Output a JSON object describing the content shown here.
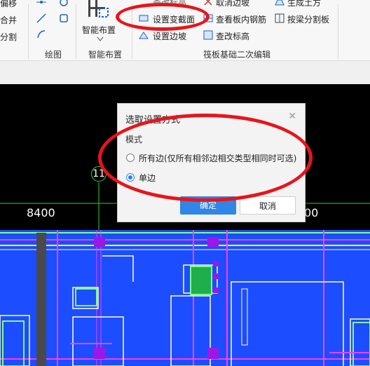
{
  "ribbon": {
    "left_items": [
      "偏移",
      "合并",
      "分割"
    ],
    "draw_group_label": "绘图",
    "smart_layout_label": "智能布置",
    "smart_layout_group_label": "智能布置",
    "tools": {
      "top_left": "设置变截面",
      "top_left_above": "查改标高",
      "middle_left": "设置变截面",
      "bottom_left": "设置边坡",
      "top_middle": "取消边坡",
      "middle_middle": "查看板内钢筋",
      "bottom_middle": "查改标高",
      "top_right": "生成土方",
      "middle_right": "按梁分割板"
    },
    "group_label": "筏板基础二次编辑"
  },
  "dialog": {
    "title": "选取设置方式",
    "section": "模式",
    "options": [
      {
        "label": "所有边(仅所有相邻边相交类型相同时可选)",
        "checked": false
      },
      {
        "label": "单边",
        "checked": true
      }
    ],
    "ok_label": "确定",
    "cancel_label": "取消"
  },
  "canvas": {
    "axis_label": "11",
    "dimension_left": "8400",
    "dimension_right": "00"
  },
  "colors": {
    "canvas_bg": "#000000",
    "plan_blue": "#1c4dff",
    "annotation": "#e8141b",
    "beam_magenta": "#ff3cff",
    "accent_blue": "#2f86e6"
  }
}
